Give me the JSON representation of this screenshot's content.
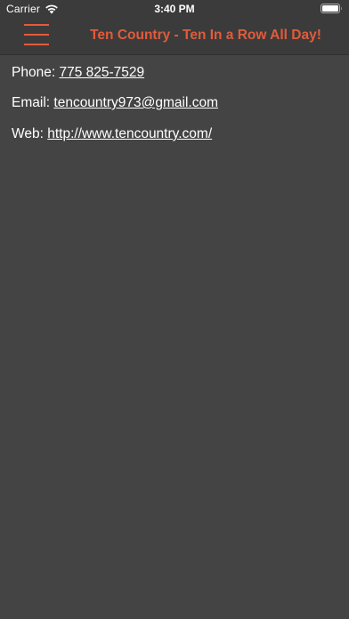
{
  "status_bar": {
    "carrier": "Carrier",
    "time": "3:40 PM",
    "icons": [
      "wifi-icon",
      "battery-icon"
    ]
  },
  "nav": {
    "menu_icon": "hamburger-menu-icon",
    "title": "Ten Country - Ten In a Row All Day!",
    "accent_color": "#e35b3b"
  },
  "contact": {
    "phone_label": "Phone:",
    "phone_value": "775 825-7529",
    "email_label": "Email:",
    "email_value": "tencountry973@gmail.com",
    "web_label": "Web:",
    "web_value": "http://www.tencountry.com/"
  },
  "colors": {
    "background": "#444444",
    "bar_background": "#3b3b3b",
    "text": "#ffffff"
  }
}
